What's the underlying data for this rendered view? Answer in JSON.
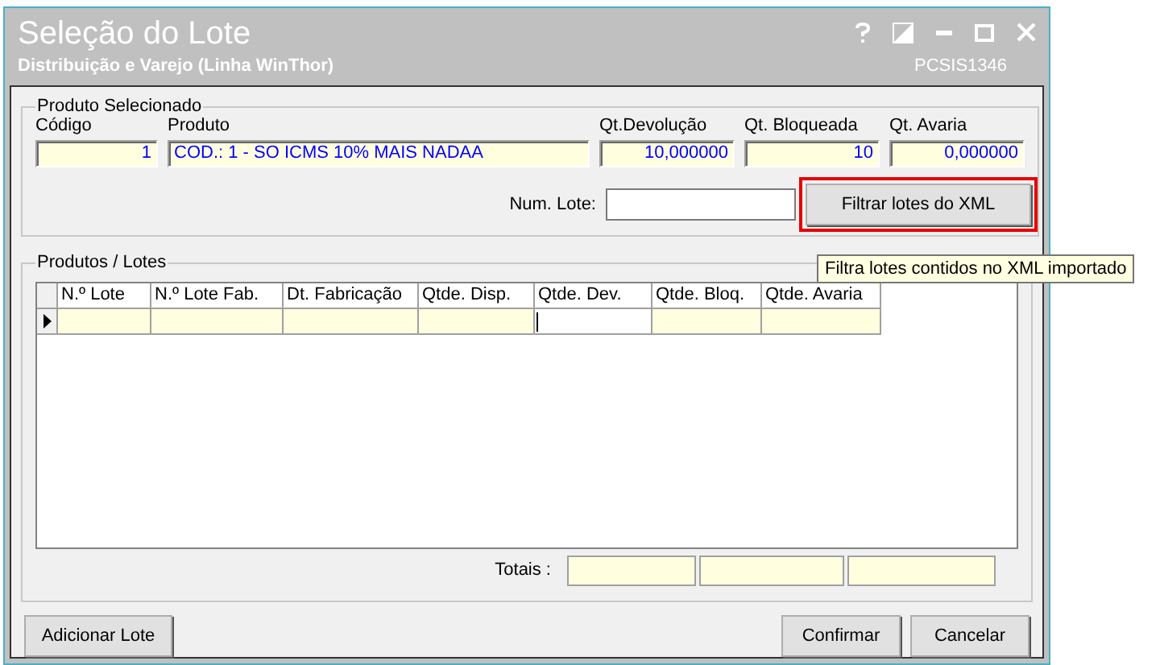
{
  "window": {
    "title": "Seleção do Lote",
    "subtitle": "Distribuição e Varejo (Linha WinThor)",
    "code": "PCSIS1346"
  },
  "product": {
    "legend": "Produto Selecionado",
    "fields": [
      {
        "label": "Código",
        "value": "1"
      },
      {
        "label": "Produto",
        "value": "COD.: 1 - SO ICMS 10% MAIS NADAA"
      },
      {
        "label": "Qt.Devolução",
        "value": "10,000000"
      },
      {
        "label": "Qt. Bloqueada",
        "value": "10"
      },
      {
        "label": "Qt. Avaria",
        "value": "0,000000"
      }
    ],
    "lot_label": "Num. Lote:",
    "filter_button": "Filtrar lotes do XML",
    "tooltip": "Filtra lotes contidos no XML importado"
  },
  "grid": {
    "legend": "Produtos / Lotes",
    "columns": [
      "N.º Lote",
      "N.º Lote Fab.",
      "Dt. Fabricação",
      "Qtde. Disp.",
      "Qtde. Dev.",
      "Qtde. Bloq.",
      "Qtde. Avaria"
    ],
    "rows": [
      {
        "current": true,
        "cells": [
          {
            "editing": false
          },
          {
            "editing": false
          },
          {
            "editing": false
          },
          {
            "editing": false
          },
          {
            "editing": true
          },
          {
            "editing": false
          },
          {
            "editing": false
          }
        ]
      }
    ],
    "totals_label": "Totais :"
  },
  "buttons": {
    "add": "Adicionar Lote",
    "confirm": "Confirmar",
    "cancel": "Cancelar"
  }
}
